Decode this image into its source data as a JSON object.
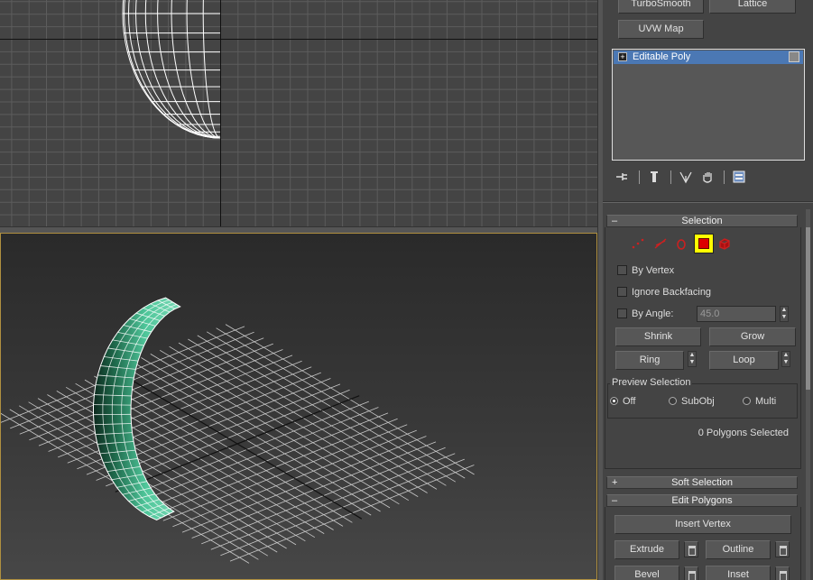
{
  "modifiers": {
    "turbosmooth": "TurboSmooth",
    "lattice": "Lattice",
    "uvw_map": "UVW Map"
  },
  "stack": {
    "items": [
      "Editable Poly"
    ]
  },
  "selection": {
    "title": "Selection",
    "collapse_sign": "–",
    "by_vertex": "By Vertex",
    "ignore_backfacing": "Ignore Backfacing",
    "by_angle": "By Angle:",
    "angle_value": "45.0",
    "shrink": "Shrink",
    "grow": "Grow",
    "ring": "Ring",
    "loop": "Loop",
    "preview_title": "Preview Selection",
    "preview_options": [
      "Off",
      "SubObj",
      "Multi"
    ],
    "preview_selected": "Off",
    "status": "0 Polygons Selected",
    "active_mode": "polygon",
    "colors": {
      "active_bg": "#ffff00",
      "polygon": "#dd0000"
    }
  },
  "soft_selection": {
    "title": "Soft Selection",
    "expand_sign": "+"
  },
  "edit_polygons": {
    "title": "Edit Polygons",
    "collapse_sign": "–",
    "insert_vertex": "Insert Vertex",
    "extrude": "Extrude",
    "outline": "Outline",
    "bevel": "Bevel",
    "inset": "Inset"
  },
  "viewport": {
    "active_border": "#b09040",
    "mesh_color": "#4fc69a"
  }
}
